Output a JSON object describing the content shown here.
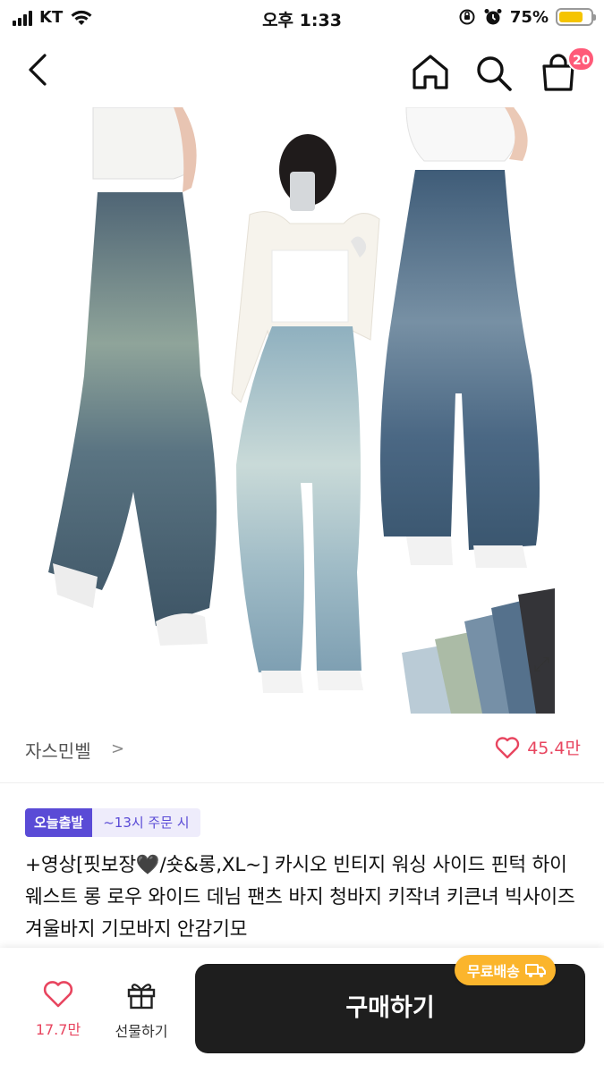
{
  "status_bar": {
    "carrier": "KT",
    "time": "오후 1:33",
    "battery_percent": "75%",
    "battery_level": 0.75,
    "battery_color": "#f5c400"
  },
  "nav": {
    "back_icon": "chevron-left-icon",
    "home_icon": "home-icon",
    "search_icon": "search-icon",
    "bag_icon": "shopping-bag-icon",
    "cart_count": "20",
    "badge_color": "#ff5a78"
  },
  "store": {
    "name": "자스민벨",
    "chevron": ">",
    "like_count": "45.4만"
  },
  "badges": {
    "today": "오늘출발",
    "cutoff": "~13시 주문 시",
    "accent": "#5a4bd6"
  },
  "product": {
    "title": "+영상[핏보장🖤/숏&롱,XL~] 카시오 빈티지 워싱 사이드 핀턱 하이웨스트 롱 로우 와이드 데님 팬츠 바지 청바지 키작녀 키큰녀 빅사이즈 겨울바지 기모바지 안감기모"
  },
  "bottom_bar": {
    "like_count": "17.7만",
    "gift_label": "선물하기",
    "buy_label": "구매하기",
    "free_shipping": "무료배송",
    "free_shipping_color": "#fbb52c",
    "like_color": "#e8455f"
  }
}
